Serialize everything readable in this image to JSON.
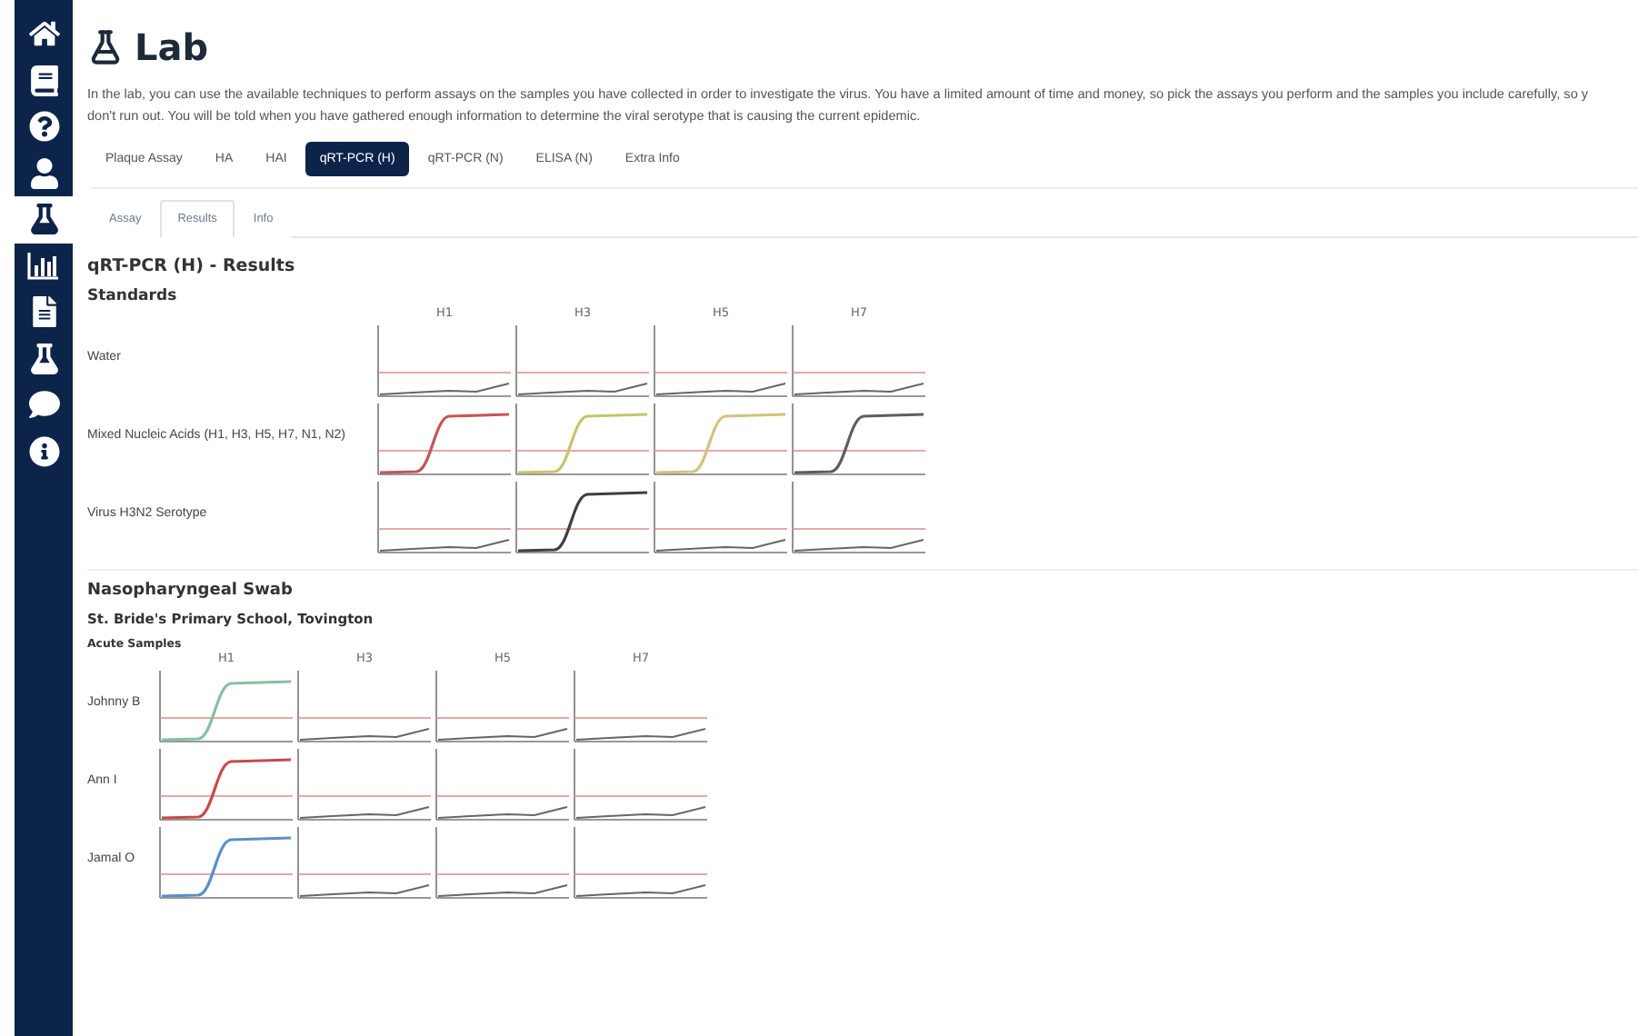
{
  "nav": [
    {
      "kind": "home",
      "selected": false
    },
    {
      "kind": "book",
      "selected": false
    },
    {
      "kind": "help",
      "selected": false
    },
    {
      "kind": "user",
      "selected": false
    },
    {
      "kind": "lab",
      "selected": true
    },
    {
      "kind": "chart",
      "selected": false
    },
    {
      "kind": "document",
      "selected": false
    },
    {
      "kind": "lab-virus",
      "selected": false
    },
    {
      "kind": "chat",
      "selected": false
    },
    {
      "kind": "info",
      "selected": false
    }
  ],
  "page": {
    "title": "Lab",
    "description": [
      "In the lab, you can use the available techniques to perform assays on the samples you have collected in order to investigate the virus. You have a limited amount of time and money, so pick the assays you perform and the samples you include carefully, so y",
      "don't run out. You will be told when you have gathered enough information to determine the viral serotype that is causing the current epidemic."
    ]
  },
  "assay_tabs": [
    {
      "label": "Plaque Assay",
      "selected": false
    },
    {
      "label": "HA",
      "selected": false
    },
    {
      "label": "HAI",
      "selected": false
    },
    {
      "label": "qRT-PCR (H)",
      "selected": true
    },
    {
      "label": "qRT-PCR (N)",
      "selected": false
    },
    {
      "label": "ELISA (N)",
      "selected": false
    },
    {
      "label": "Extra Info",
      "selected": false
    }
  ],
  "view_tabs": [
    {
      "label": "Assay",
      "selected": false
    },
    {
      "label": "Results",
      "selected": true
    },
    {
      "label": "Info",
      "selected": false
    }
  ],
  "results_title": "qRT-PCR (H) - Results",
  "standards": {
    "heading": "Standards",
    "columns": [
      "H1",
      "H3",
      "H5",
      "H7"
    ],
    "rows": [
      {
        "label": "Water",
        "plots": [
          {
            "positive": false
          },
          {
            "positive": false
          },
          {
            "positive": false
          },
          {
            "positive": false
          }
        ]
      },
      {
        "label": "Mixed Nucleic Acids (H1, H3, H5, H7, N1, N2)",
        "plots": [
          {
            "positive": true,
            "color": "#c45656"
          },
          {
            "positive": true,
            "color": "#c8c46a"
          },
          {
            "positive": true,
            "color": "#d2c27e"
          },
          {
            "positive": true,
            "color": "#5e5e5e"
          }
        ]
      },
      {
        "label": "Virus H3N2 Serotype",
        "plots": [
          {
            "positive": false
          },
          {
            "positive": true,
            "color": "#3f3f3f"
          },
          {
            "positive": false
          },
          {
            "positive": false
          }
        ]
      }
    ]
  },
  "swab": {
    "heading": "Nasopharyngeal Swab",
    "location": "St. Bride's Primary School, Tovington",
    "group": "Acute Samples",
    "columns": [
      "H1",
      "H3",
      "H5",
      "H7"
    ],
    "rows": [
      {
        "label": "Johnny B",
        "plots": [
          {
            "positive": true,
            "color": "#86c0a0"
          },
          {
            "positive": false
          },
          {
            "positive": false
          },
          {
            "positive": false
          }
        ]
      },
      {
        "label": "Ann I",
        "plots": [
          {
            "positive": true,
            "color": "#c84a4a"
          },
          {
            "positive": false
          },
          {
            "positive": false
          },
          {
            "positive": false
          }
        ]
      },
      {
        "label": "Jamal O",
        "plots": [
          {
            "positive": true,
            "color": "#5b8fc7"
          },
          {
            "positive": false
          },
          {
            "positive": false
          },
          {
            "positive": false
          }
        ]
      }
    ]
  }
}
